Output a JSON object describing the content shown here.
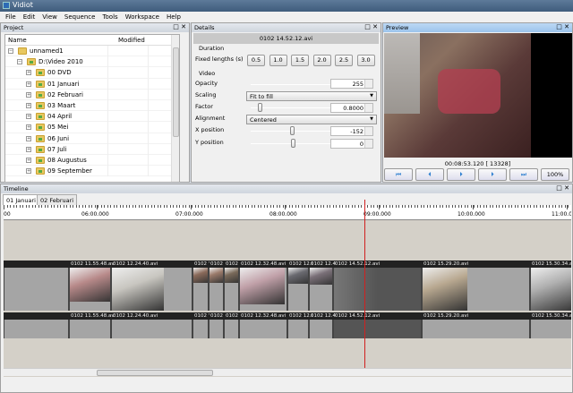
{
  "app": {
    "title": "Vidiot"
  },
  "menu": [
    "File",
    "Edit",
    "View",
    "Sequence",
    "Tools",
    "Workspace",
    "Help"
  ],
  "project": {
    "title": "Project",
    "columns": {
      "name": "Name",
      "modified": "Modified"
    },
    "items": [
      {
        "label": "unnamed1",
        "level": 0
      },
      {
        "label": "D:\\Video 2010",
        "level": 1
      },
      {
        "label": "00 DVD",
        "level": 2
      },
      {
        "label": "01 Januari",
        "level": 2
      },
      {
        "label": "02 Februari",
        "level": 2
      },
      {
        "label": "03 Maart",
        "level": 2
      },
      {
        "label": "04 April",
        "level": 2
      },
      {
        "label": "05 Mei",
        "level": 2
      },
      {
        "label": "06 Juni",
        "level": 2
      },
      {
        "label": "07 Juli",
        "level": 2
      },
      {
        "label": "08 Augustus",
        "level": 2
      },
      {
        "label": "09 September",
        "level": 2
      }
    ]
  },
  "details": {
    "title": "Details",
    "filename": "0102 14.52.12.avi",
    "duration_section": "Duration",
    "fixed_lengths_label": "Fixed lengths (s)",
    "fixed_lengths": [
      "0.5",
      "1.0",
      "1.5",
      "2.0",
      "2.5",
      "3.0"
    ],
    "video_section": "Video",
    "opacity": {
      "label": "Opacity",
      "value": "255",
      "slider": 1.0
    },
    "scaling": {
      "label": "Scaling",
      "value": "Fit to fill"
    },
    "factor": {
      "label": "Factor",
      "value": "0.8000",
      "slider": 0.12
    },
    "alignment": {
      "label": "Alignment",
      "value": "Centered"
    },
    "xpos": {
      "label": "X position",
      "value": "-152",
      "slider": 0.45
    },
    "ypos": {
      "label": "Y position",
      "value": "0",
      "slider": 0.5
    }
  },
  "preview": {
    "title": "Preview",
    "time": "00:08:53.120 [    13328]",
    "zoom": "100%",
    "buttons": [
      "skip-to-start",
      "step-back",
      "play",
      "step-forward",
      "skip-to-end"
    ]
  },
  "timeline": {
    "title": "Timeline",
    "tabs": [
      "01 Januari",
      "02 Februari"
    ],
    "active_tab": 0,
    "ruler": [
      "00",
      "06:00.000",
      "07:00.000",
      "08:00.000",
      "09:00.000",
      "10:00.000",
      "11:00.0"
    ],
    "playhead": "00:08:53.120",
    "clips": [
      "",
      "0102 11.55.48.avi",
      "0102 12.24.40.avi",
      "0102 '",
      "0102",
      "0102",
      "0102 12.32.48.avi",
      "0102 12.0",
      "0102 12.4",
      "0102 14.52.12.avi",
      "0102 15.29.20.avi",
      "0102 15.30.34.avi"
    ]
  },
  "colors": {
    "playhead": "#d02020",
    "selected_clip": "#555555",
    "clip": "#a5a5a5",
    "accent": "#2d7fd0"
  }
}
